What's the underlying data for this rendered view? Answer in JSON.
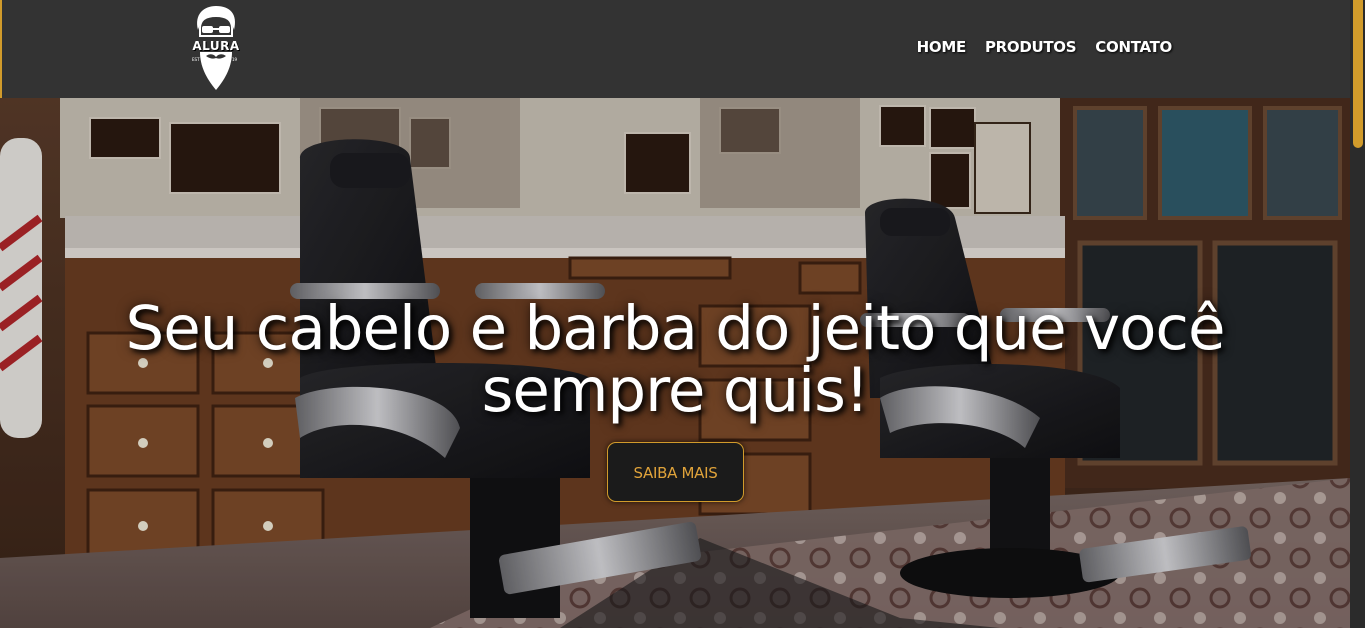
{
  "header": {
    "logo": {
      "text": "ALURA",
      "icon": "bearded-man-logo-icon"
    },
    "nav": [
      {
        "label": "HOME"
      },
      {
        "label": "PRODUTOS"
      },
      {
        "label": "CONTATO"
      }
    ]
  },
  "hero": {
    "title_line1": "Seu cabelo e barba do jeito que você",
    "title_line2": "sempre quis!",
    "cta_label": "SAIBA MAIS",
    "background": "barbershop-interior-photo"
  },
  "colors": {
    "header_bg": "#333333",
    "accent": "#d19b2b",
    "cta_text": "#e0a33a",
    "cta_bg": "#1b1b1b",
    "title_text": "#ffffff"
  }
}
